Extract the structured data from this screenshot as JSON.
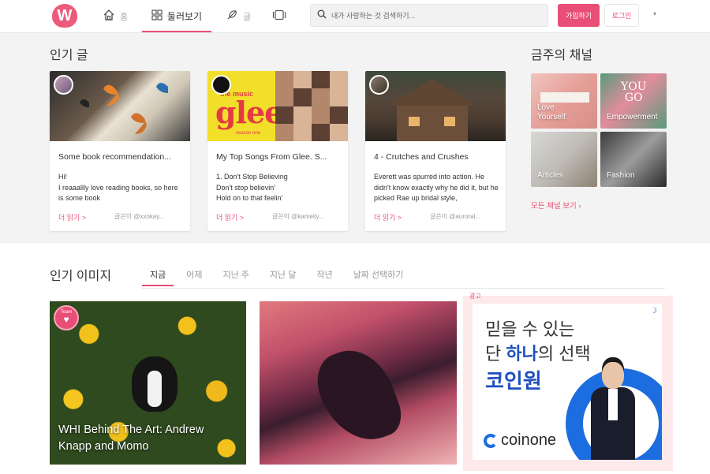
{
  "header": {
    "logo": "W",
    "nav": {
      "home_label": "홈",
      "explore_label": "둘러보기",
      "write_label": "글",
      "collections_label": ""
    },
    "search_placeholder": "내가 사랑하는 것 검색하기...",
    "join_label": "가입하기",
    "login_label": "로그인",
    "caret": "▾"
  },
  "popular_posts": {
    "title": "인기 글",
    "cards": [
      {
        "title": "Some book recommendation...",
        "body": "Hi!\nI reaaallly love reading books, so here is some book",
        "more": "더 읽기 >",
        "author": "글쓴이 @xxokay..."
      },
      {
        "title": "My Top Songs From Glee. S...",
        "body": "1. Don't Stop Believing\nDon't stop believin'\nHold on to that feelin'",
        "more": "더 읽기 >",
        "author": "글쓴이 @kameliy...",
        "thumb_text": {
          "the_music": "the music",
          "logo": "glee",
          "season": "season one"
        }
      },
      {
        "title": "4 - Crutches and Crushes",
        "body": "Everett was spurred into action. He didn't know exactly why he did it, but he picked Rae up bridal style,",
        "more": "더 읽기 >",
        "author": "글쓴이 @aurorat..."
      }
    ]
  },
  "channels": {
    "title": "금주의 채널",
    "items": [
      {
        "label": "Love\nYourself"
      },
      {
        "label": "Empowerment",
        "overlay": "YOU\nGO"
      },
      {
        "label": "Articles"
      },
      {
        "label": "Fashion"
      }
    ],
    "view_all": "모든 채널 보기 ›"
  },
  "popular_images": {
    "title": "인기 이미지",
    "tabs": [
      "지금",
      "어제",
      "지난 주",
      "지난 달",
      "작년",
      "날짜 선택하기"
    ],
    "active_tab": "지금",
    "items": [
      {
        "caption": "WHI Behind The Art: Andrew Knapp and Momo",
        "badge": "Team"
      },
      {
        "caption": ""
      }
    ]
  },
  "ad": {
    "label": "광고",
    "line1": "믿을 수 있는",
    "line2_prefix": "단 ",
    "line2_bold": "하나",
    "line2_suffix": "의 선택",
    "line3": "코인원",
    "brand": "coinone",
    "corner_icon": "☽"
  },
  "colors": {
    "accent": "#e94e77",
    "brand_blue": "#1c6de0"
  }
}
